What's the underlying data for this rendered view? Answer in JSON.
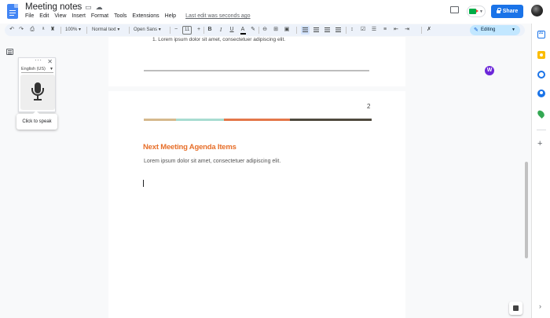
{
  "header": {
    "title": "Meeting notes",
    "menu": [
      "File",
      "Edit",
      "View",
      "Insert",
      "Format",
      "Tools",
      "Extensions",
      "Help"
    ],
    "last_edit": "Last edit was seconds ago",
    "share_label": "Share"
  },
  "toolbar": {
    "zoom": "100%",
    "style": "Normal text",
    "font": "Open Sans",
    "font_size": "11",
    "mode": "Editing"
  },
  "voice_typing": {
    "language": "English (US)",
    "tooltip": "Click to speak"
  },
  "document": {
    "page1_list_item": "1.   Lorem ipsum dolor sit amet, consectetuer adipiscing elit.",
    "page_number": "2",
    "heading": "Next Meeting Agenda Items",
    "body": "Lorem ipsum dolor sit amet, consectetuer adipiscing elit.",
    "color_bar": [
      "#d6b98d",
      "#a8dcd1",
      "#e4774a",
      "#4f4a3e"
    ]
  },
  "extension_badge": "W"
}
